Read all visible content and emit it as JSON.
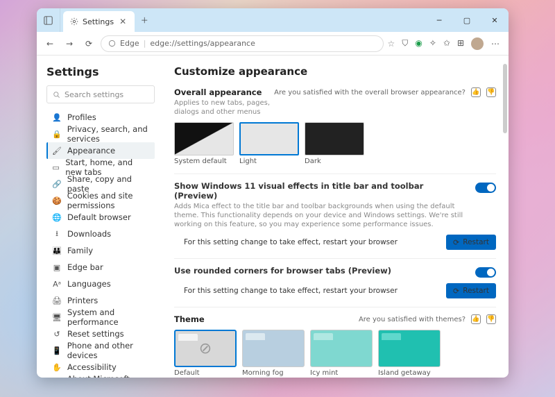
{
  "window": {
    "tab_title": "Settings",
    "address_label": "Edge",
    "address_url": "edge://settings/appearance"
  },
  "sidebar": {
    "title": "Settings",
    "search_placeholder": "Search settings",
    "items": [
      {
        "icon": "person",
        "label": "Profiles"
      },
      {
        "icon": "lock",
        "label": "Privacy, search, and services"
      },
      {
        "icon": "brush",
        "label": "Appearance",
        "active": true
      },
      {
        "icon": "tab",
        "label": "Start, home, and new tabs"
      },
      {
        "icon": "share",
        "label": "Share, copy and paste"
      },
      {
        "icon": "cookie",
        "label": "Cookies and site permissions"
      },
      {
        "icon": "browser",
        "label": "Default browser"
      },
      {
        "icon": "download",
        "label": "Downloads"
      },
      {
        "icon": "family",
        "label": "Family"
      },
      {
        "icon": "edge",
        "label": "Edge bar"
      },
      {
        "icon": "lang",
        "label": "Languages"
      },
      {
        "icon": "printer",
        "label": "Printers"
      },
      {
        "icon": "system",
        "label": "System and performance"
      },
      {
        "icon": "reset",
        "label": "Reset settings"
      },
      {
        "icon": "phone",
        "label": "Phone and other devices"
      },
      {
        "icon": "access",
        "label": "Accessibility"
      },
      {
        "icon": "about",
        "label": "About Microsoft Edge"
      }
    ]
  },
  "main": {
    "heading": "Customize appearance",
    "overall": {
      "title": "Overall appearance",
      "desc": "Applies to new tabs, pages, dialogs and other menus",
      "feedback": "Are you satisfied with the overall browser appearance?",
      "options": [
        {
          "label": "System default"
        },
        {
          "label": "Light"
        },
        {
          "label": "Dark"
        }
      ],
      "selected": 1
    },
    "visual_effects": {
      "title": "Show Windows 11 visual effects in title bar and toolbar (Preview)",
      "desc": "Adds Mica effect to the title bar and toolbar backgrounds when using the default theme. This functionality depends on your device and Windows settings. We're still working on this feature, so you may experience some performance issues.",
      "restart_msg": "For this setting change to take effect, restart your browser",
      "restart_btn": "Restart",
      "on": true
    },
    "rounded": {
      "title": "Use rounded corners for browser tabs (Preview)",
      "restart_msg": "For this setting change to take effect, restart your browser",
      "restart_btn": "Restart",
      "on": true
    },
    "theme": {
      "title": "Theme",
      "feedback": "Are you satisfied with themes?",
      "items": [
        {
          "label": "Default"
        },
        {
          "label": "Morning fog"
        },
        {
          "label": "Icy mint"
        },
        {
          "label": "Island getaway"
        }
      ],
      "selected": 0
    }
  }
}
